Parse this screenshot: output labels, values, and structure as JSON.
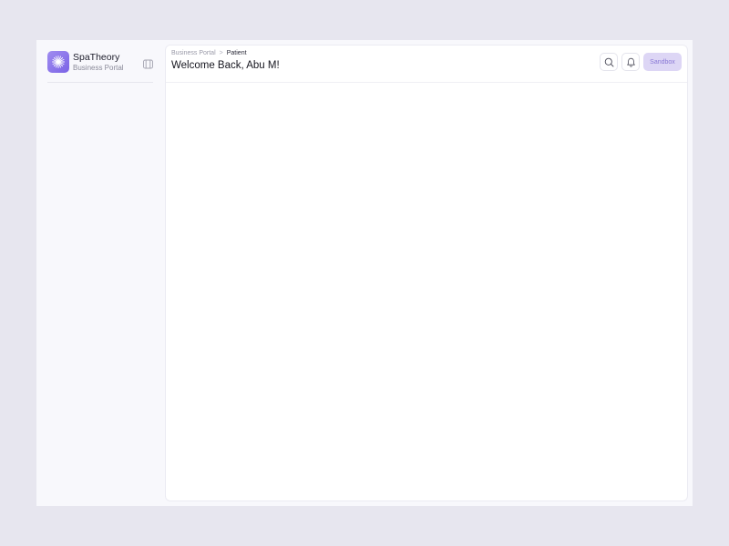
{
  "brand": {
    "name": "SpaTheory",
    "subtitle": "Business Portal",
    "logo_icon": "sparkle-icon",
    "accent_color": "#8b74ea"
  },
  "sidebar": {
    "collapse_icon": "sidebar-toggle-icon"
  },
  "header": {
    "breadcrumb": {
      "parent": "Business Portal",
      "separator": ">",
      "current": "Patient"
    },
    "title": "Welcome Back, Abu M!",
    "search_icon": "search-icon",
    "notification_icon": "bell-icon",
    "sandbox_label": "Sandbox"
  }
}
